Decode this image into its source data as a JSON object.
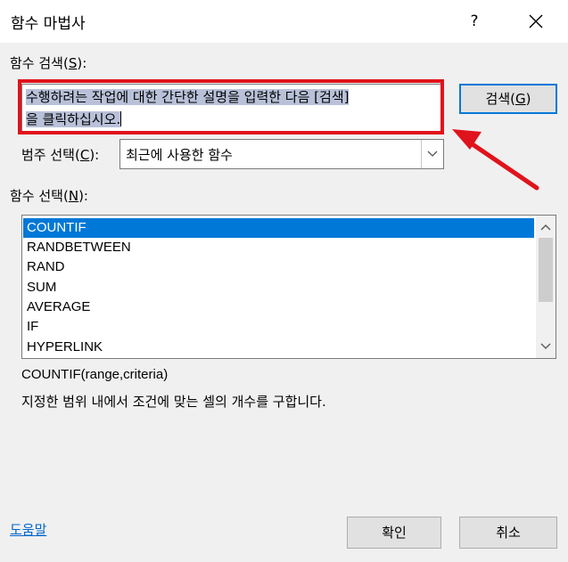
{
  "window": {
    "title": "함수 마법사",
    "help": "?"
  },
  "search": {
    "label_pre": "함수 검색(",
    "label_key": "S",
    "label_post": "):",
    "value_line1": "수행하려는 작업에 대한 간단한 설명을 입력한 다음 [검색]",
    "value_line2": "을 클릭하십시오.",
    "button_pre": "검색(",
    "button_key": "G",
    "button_post": ")"
  },
  "category": {
    "label_pre": "범주 선택(",
    "label_key": "C",
    "label_post": "):",
    "value": "최근에 사용한 함수"
  },
  "functions": {
    "label_pre": "함수 선택(",
    "label_key": "N",
    "label_post": "):",
    "items": [
      "COUNTIF",
      "RANDBETWEEN",
      "RAND",
      "SUM",
      "AVERAGE",
      "IF",
      "HYPERLINK"
    ],
    "selected": "COUNTIF"
  },
  "details": {
    "syntax": "COUNTIF(range,criteria)",
    "description": "지정한 범위 내에서 조건에 맞는 셀의 개수를 구합니다."
  },
  "footer": {
    "help_link": "도움말",
    "ok": "확인",
    "cancel": "취소"
  },
  "colors": {
    "highlight": "#e0131c",
    "selection": "#0078d7"
  }
}
